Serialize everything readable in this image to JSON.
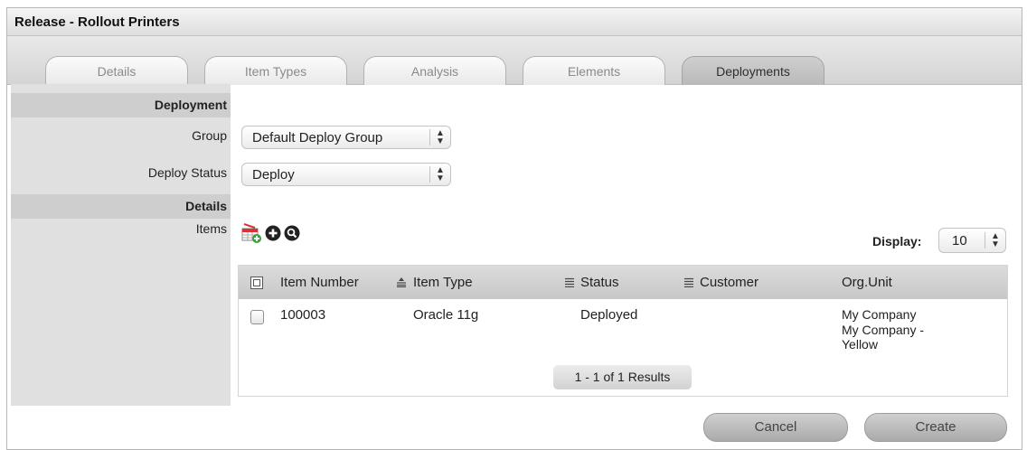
{
  "window": {
    "title": "Release - Rollout Printers"
  },
  "tabs": [
    {
      "label": "Details",
      "active": false
    },
    {
      "label": "Item Types",
      "active": false
    },
    {
      "label": "Analysis",
      "active": false
    },
    {
      "label": "Elements",
      "active": false
    },
    {
      "label": "Deployments",
      "active": true
    }
  ],
  "deployment": {
    "section_label": "Deployment",
    "group_label": "Group",
    "group_value": "Default Deploy Group",
    "deploy_status_label": "Deploy Status",
    "deploy_status_value": "Deploy"
  },
  "details": {
    "section_label": "Details",
    "items_label": "Items",
    "icons": [
      "add-table-icon",
      "add-circle-icon",
      "search-circle-icon"
    ],
    "display_label": "Display:",
    "display_value": "10"
  },
  "items_table": {
    "columns": [
      "Item Number",
      "Item Type",
      "Status",
      "Customer",
      "Org.Unit"
    ],
    "rows": [
      {
        "item_number": "100003",
        "item_type": "Oracle 11g",
        "status": "Deployed",
        "customer": "",
        "org_unit_line1": "My Company",
        "org_unit_line2": "My Company -",
        "org_unit_line3": "Yellow"
      }
    ],
    "pagination": "1 - 1 of 1 Results"
  },
  "buttons": {
    "cancel": "Cancel",
    "create": "Create"
  },
  "colors": {
    "header_bg": "#c9c9c9",
    "label_col_bg": "#e0e0e0",
    "section_bg": "#cecece"
  }
}
